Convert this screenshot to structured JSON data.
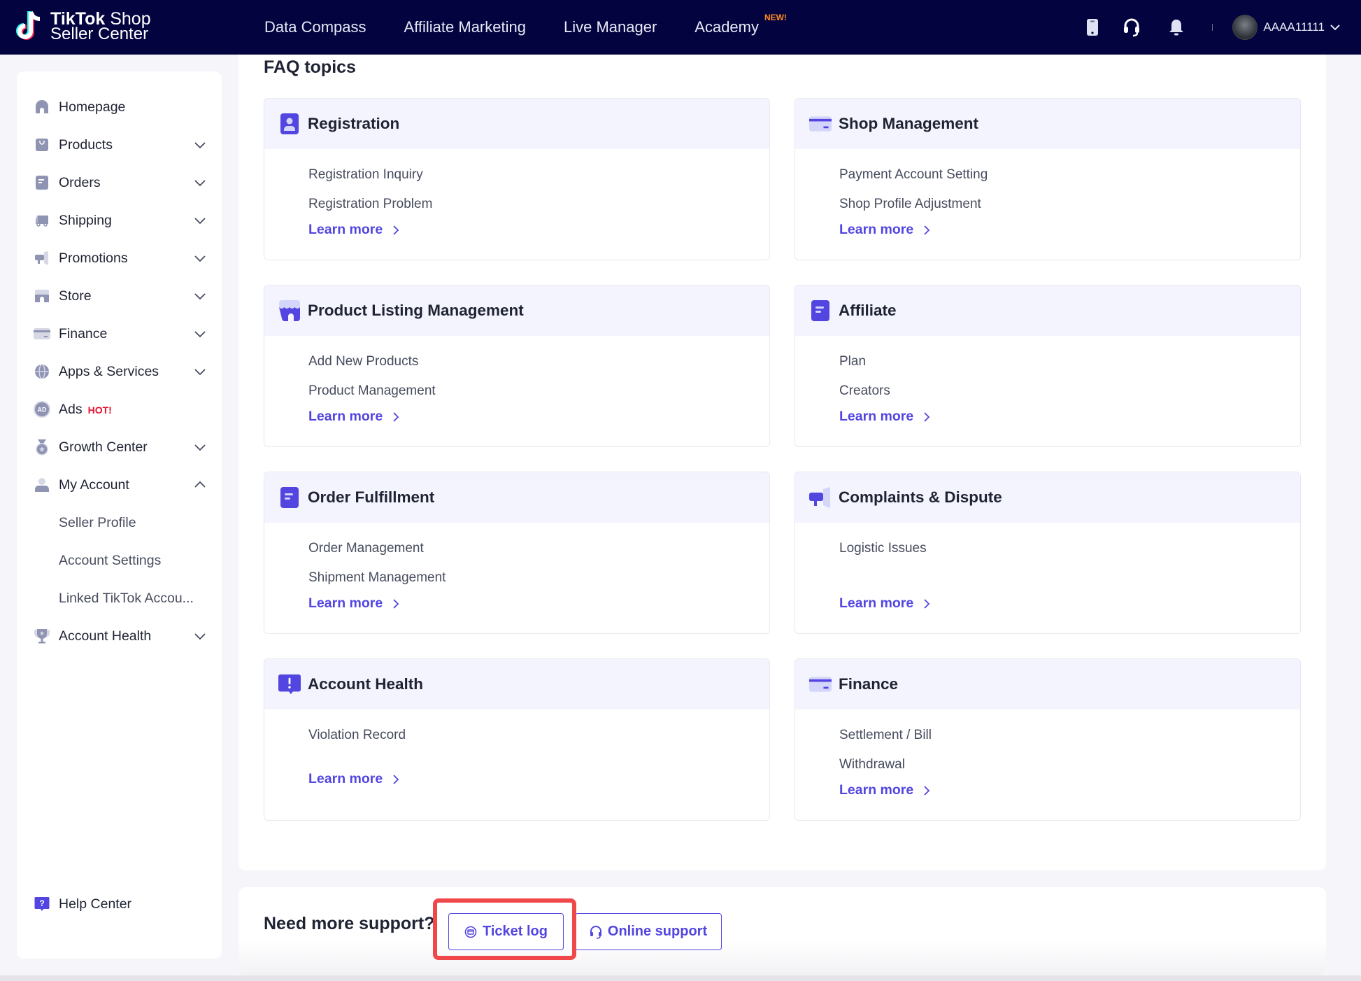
{
  "header": {
    "logo_line1_bold": "TikTok",
    "logo_line1_rest": " Shop",
    "logo_line2": "Seller Center",
    "nav": [
      {
        "label": "Data Compass"
      },
      {
        "label": "Affiliate Marketing"
      },
      {
        "label": "Live Manager"
      },
      {
        "label": "Academy",
        "badge": "NEW!"
      }
    ],
    "icons": [
      "mobile-icon",
      "headset-icon",
      "bell-icon"
    ],
    "username": "AAAA11111"
  },
  "sidebar": {
    "items": [
      {
        "label": "Homepage",
        "icon": "home-icon",
        "expandable": false
      },
      {
        "label": "Products",
        "icon": "shopping-bag-icon",
        "expandable": true
      },
      {
        "label": "Orders",
        "icon": "orders-icon",
        "expandable": true
      },
      {
        "label": "Shipping",
        "icon": "truck-icon",
        "expandable": true
      },
      {
        "label": "Promotions",
        "icon": "megaphone-icon",
        "expandable": true
      },
      {
        "label": "Store",
        "icon": "store-icon",
        "expandable": true
      },
      {
        "label": "Finance",
        "icon": "card-icon",
        "expandable": true
      },
      {
        "label": "Apps & Services",
        "icon": "globe-icon",
        "expandable": true
      },
      {
        "label": "Ads",
        "icon": "ad-icon",
        "badge": "HOT!",
        "expandable": false
      },
      {
        "label": "Growth Center",
        "icon": "medal-icon",
        "expandable": true
      },
      {
        "label": "My Account",
        "icon": "user-icon",
        "expandable": true,
        "expanded": true
      },
      {
        "label": "Seller Profile",
        "sub": true
      },
      {
        "label": "Account Settings",
        "sub": true
      },
      {
        "label": "Linked TikTok Accou...",
        "sub": true
      },
      {
        "label": "Account Health",
        "icon": "trophy-icon",
        "expandable": true
      }
    ],
    "help_center": "Help Center"
  },
  "main": {
    "faq_title": "FAQ topics",
    "learn_more": "Learn more",
    "cards": [
      {
        "title": "Registration",
        "icon": "user-badge-icon",
        "links": [
          "Registration Inquiry",
          "Registration Problem"
        ]
      },
      {
        "title": "Shop Management",
        "icon": "card-icon",
        "links": [
          "Payment Account Setting",
          "Shop Profile Adjustment"
        ]
      },
      {
        "title": "Product Listing Management",
        "icon": "store-icon",
        "links": [
          "Add New Products",
          "Product Management"
        ]
      },
      {
        "title": "Affiliate",
        "icon": "document-icon",
        "links": [
          "Plan",
          "Creators"
        ]
      },
      {
        "title": "Order Fulfillment",
        "icon": "document-icon",
        "links": [
          "Order Management",
          "Shipment Management"
        ]
      },
      {
        "title": "Complaints & Dispute",
        "icon": "megaphone-icon",
        "links": [
          "Logistic Issues"
        ]
      },
      {
        "title": "Account Health",
        "icon": "alert-icon",
        "links": [
          "Violation Record"
        ]
      },
      {
        "title": "Finance",
        "icon": "card-icon",
        "links": [
          "Settlement / Bill",
          "Withdrawal"
        ]
      }
    ]
  },
  "support": {
    "label": "Need more support?",
    "ticket_log": "Ticket log",
    "online_support": "Online support"
  },
  "colors": {
    "header_bg": "#030340",
    "accent": "#5245e0",
    "hot": "#e8102c",
    "new_badge": "#ff8a1f",
    "highlight": "#f0484a"
  }
}
